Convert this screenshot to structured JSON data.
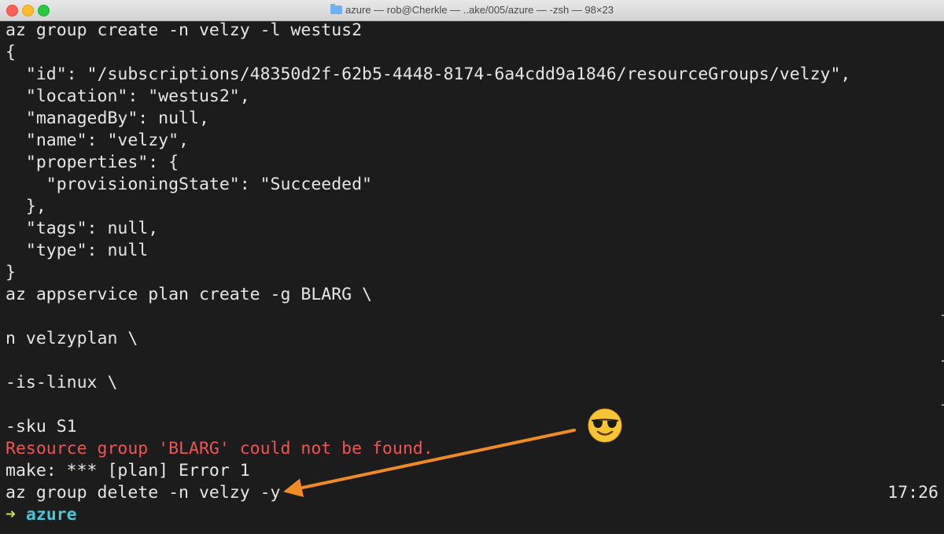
{
  "window": {
    "title": "azure — rob@Cherkle — ..ake/005/azure — -zsh — 98×23"
  },
  "terminal": {
    "lines": [
      "az group create -n velzy -l westus2",
      "{",
      "  \"id\": \"/subscriptions/48350d2f-62b5-4448-8174-6a4cdd9a1846/resourceGroups/velzy\",",
      "  \"location\": \"westus2\",",
      "  \"managedBy\": null,",
      "  \"name\": \"velzy\",",
      "  \"properties\": {",
      "    \"provisioningState\": \"Succeeded\"",
      "  },",
      "  \"tags\": null,",
      "  \"type\": null",
      "}",
      "az appservice plan create -g BLARG \\",
      "",
      "n velzyplan \\",
      "",
      "-is-linux \\",
      "",
      "-sku S1",
      "Resource group 'BLARG' could not be found.",
      "make: *** [plan] Error 1",
      "az group delete -n velzy -y"
    ],
    "prompt_arrow": "➜",
    "prompt_dir": "azure",
    "right_prompt_time": "17:26"
  },
  "colors": {
    "background": "#1c1c1c",
    "text": "#e6e6e6",
    "error": "#ee5555",
    "prompt_arrow": "#c8e04a",
    "prompt_dir": "#46c8d9",
    "annotation_arrow": "#f08a24"
  },
  "annotation": {
    "emoji": "smiling-face-with-sunglasses-icon",
    "arrow": "orange-arrow-icon"
  }
}
